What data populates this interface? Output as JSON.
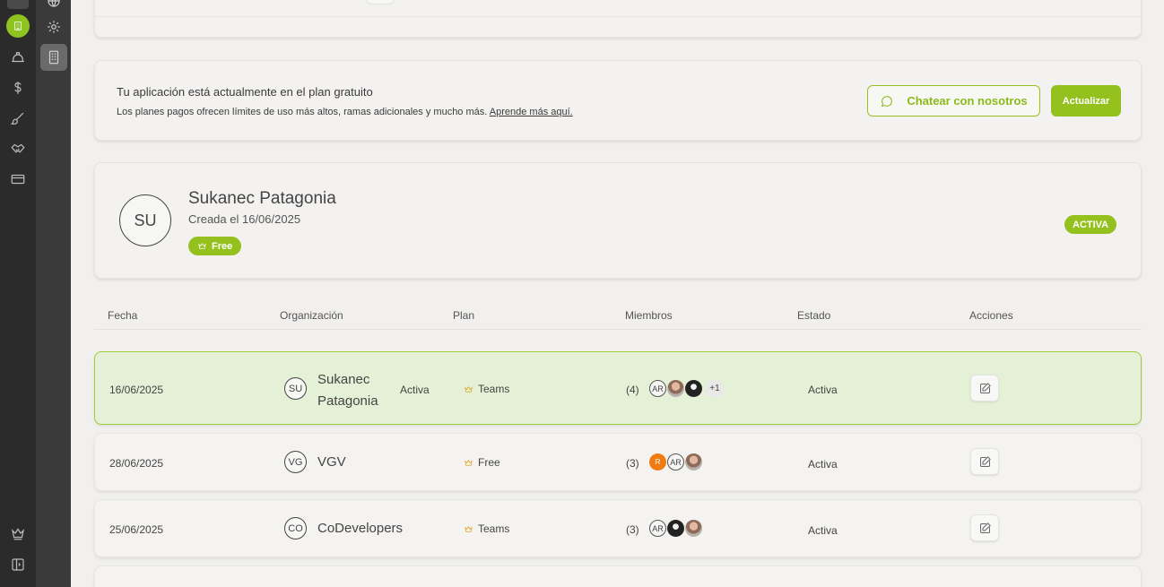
{
  "plan_banner": {
    "title": "Tu aplicación está actualmente en el plan gratuito",
    "subtitle": "Los planes pagos ofrecen límites de uso más altos, ramas adicionales y mucho más.",
    "link": "Aprende más aquí.",
    "chat_button": "Chatear con nosotros",
    "upgrade_button": "Actualizar"
  },
  "org": {
    "initials": "SU",
    "name": "Sukanec Patagonia",
    "created": "Creada el 16/06/2025",
    "plan_badge": "Free",
    "status_badge": "ACTIVA"
  },
  "table": {
    "headers": [
      "Fecha",
      "Organización",
      "Plan",
      "Miembros",
      "Estado",
      "Acciones"
    ],
    "rows": [
      {
        "date": "16/06/2025",
        "initials": "SU",
        "name": "Sukanec Patagonia",
        "org_state": "Activa",
        "plan": "Teams",
        "count": "(4)",
        "more": "+1",
        "status": "Activa"
      },
      {
        "date": "28/06/2025",
        "initials": "VG",
        "name": "VGV",
        "plan": "Free",
        "count": "(3)",
        "r_initial": "R",
        "status": "Activa"
      },
      {
        "date": "25/06/2025",
        "initials": "CO",
        "name": "CoDevelopers",
        "plan": "Teams",
        "count": "(3)",
        "status": "Activa"
      }
    ],
    "member_ar": "AR"
  },
  "colors": {
    "accent": "#95c11f",
    "crown": "#e0a21a",
    "rail": "#2b2b2b"
  },
  "icons": [
    "home-icon",
    "building-icon",
    "hardhat-icon",
    "dollar-icon",
    "brush-icon",
    "handshake-icon",
    "card-icon",
    "crown-icon",
    "sidebar-toggle-icon",
    "globe-icon",
    "gear-icon",
    "chat-icon",
    "edit-icon"
  ]
}
